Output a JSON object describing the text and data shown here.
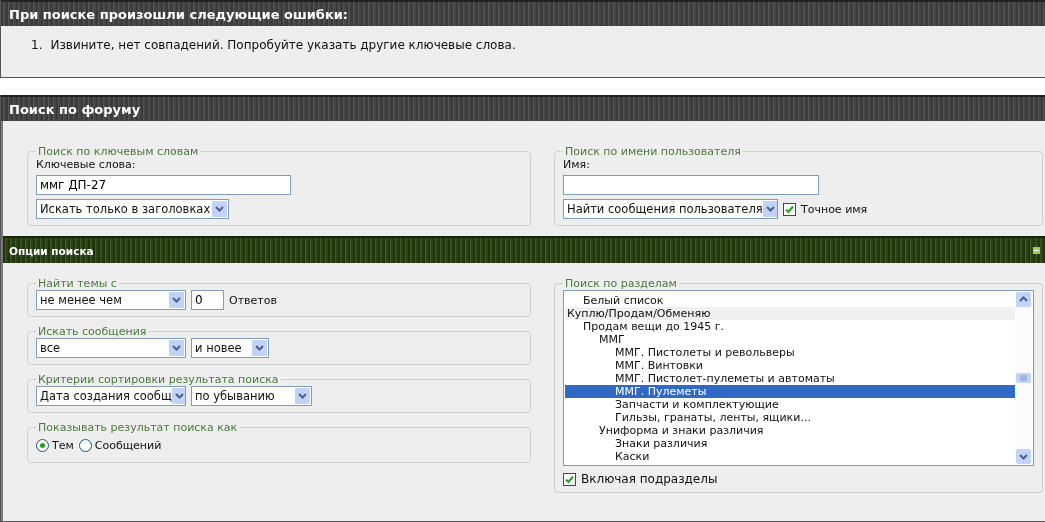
{
  "error_box": {
    "title": "При поиске произошли следующие ошибки:",
    "items": [
      {
        "number": "1.",
        "text": "Извините, нет совпадений. Попробуйте указать другие ключевые слова."
      }
    ]
  },
  "search_panel": {
    "title": "Поиск по форуму",
    "keywords": {
      "legend": "Поиск по ключевым словам",
      "label": "Ключевые слова:",
      "value": "ммг ДП-27",
      "mode": "Искать только в заголовках"
    },
    "user": {
      "legend": "Поиск по имени пользователя",
      "label": "Имя:",
      "mode": "Найти сообщения пользователя",
      "exact": {
        "label": "Точное имя",
        "checked": true
      }
    },
    "options": {
      "title": "Опции поиска",
      "expanded": true,
      "topics": {
        "legend": "Найти темы с",
        "mode": "не менее чем",
        "count": "0",
        "unit": "Ответов"
      },
      "posts": {
        "legend": "Искать сообщения",
        "age": "все",
        "direction": "и новее"
      },
      "sort": {
        "legend": "Критерии сортировки результата поиска",
        "field": "Дата создания сообщ",
        "order": "по убыванию"
      },
      "show": {
        "legend": "Показывать результат поиска как",
        "choices": [
          {
            "label": "Тем",
            "selected": true
          },
          {
            "label": "Сообщений",
            "selected": false
          }
        ]
      },
      "sections": {
        "legend": "Поиск по разделам",
        "items": [
          {
            "children": [
              {
                "label": "Белый список",
                "selected": false
              }
            ]
          },
          {
            "label": "Куплю/Продам/Обменяю",
            "kind": "category",
            "selected": false,
            "children": [
              {
                "label": "Продам вещи до 1945 г.",
                "selected": false,
                "children": [
                  {
                    "label": "ММГ",
                    "selected": false,
                    "children": [
                      {
                        "label": "ММГ. Пистолеты и револьверы",
                        "selected": false
                      },
                      {
                        "label": "ММГ. Винтовки",
                        "selected": false
                      },
                      {
                        "label": "ММГ. Пистолет-пулеметы и автоматы",
                        "selected": false
                      },
                      {
                        "label": "ММГ. Пулеметы",
                        "selected": true
                      },
                      {
                        "label": "Запчасти и комплектующие",
                        "selected": false
                      },
                      {
                        "label": "Гильзы, гранаты, ленты, ящики...",
                        "selected": false
                      }
                    ]
                  },
                  {
                    "label": "Униформа и знаки различия",
                    "selected": false,
                    "children": [
                      {
                        "label": "Знаки различия",
                        "selected": false
                      },
                      {
                        "label": "Каски",
                        "selected": false
                      }
                    ]
                  }
                ]
              }
            ]
          }
        ],
        "subforums": {
          "label": "Включая подразделы",
          "checked": true
        }
      }
    }
  }
}
